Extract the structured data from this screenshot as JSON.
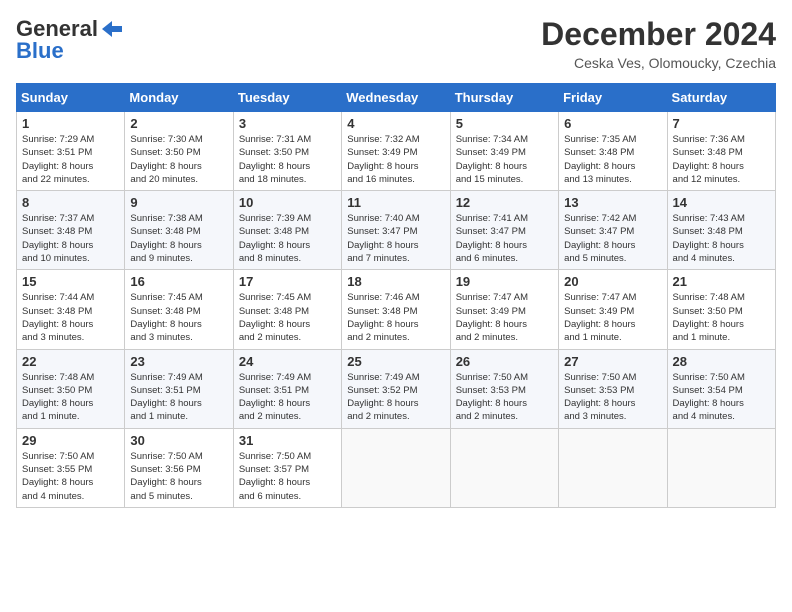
{
  "logo": {
    "line1": "General",
    "line2": "Blue"
  },
  "title": "December 2024",
  "location": "Ceska Ves, Olomoucky, Czechia",
  "days_of_week": [
    "Sunday",
    "Monday",
    "Tuesday",
    "Wednesday",
    "Thursday",
    "Friday",
    "Saturday"
  ],
  "weeks": [
    [
      {
        "day": 1,
        "sunrise": "7:29 AM",
        "sunset": "3:51 PM",
        "daylight": "8 hours and 22 minutes."
      },
      {
        "day": 2,
        "sunrise": "7:30 AM",
        "sunset": "3:50 PM",
        "daylight": "8 hours and 20 minutes."
      },
      {
        "day": 3,
        "sunrise": "7:31 AM",
        "sunset": "3:50 PM",
        "daylight": "8 hours and 18 minutes."
      },
      {
        "day": 4,
        "sunrise": "7:32 AM",
        "sunset": "3:49 PM",
        "daylight": "8 hours and 16 minutes."
      },
      {
        "day": 5,
        "sunrise": "7:34 AM",
        "sunset": "3:49 PM",
        "daylight": "8 hours and 15 minutes."
      },
      {
        "day": 6,
        "sunrise": "7:35 AM",
        "sunset": "3:48 PM",
        "daylight": "8 hours and 13 minutes."
      },
      {
        "day": 7,
        "sunrise": "7:36 AM",
        "sunset": "3:48 PM",
        "daylight": "8 hours and 12 minutes."
      }
    ],
    [
      {
        "day": 8,
        "sunrise": "7:37 AM",
        "sunset": "3:48 PM",
        "daylight": "8 hours and 10 minutes."
      },
      {
        "day": 9,
        "sunrise": "7:38 AM",
        "sunset": "3:48 PM",
        "daylight": "8 hours and 9 minutes."
      },
      {
        "day": 10,
        "sunrise": "7:39 AM",
        "sunset": "3:48 PM",
        "daylight": "8 hours and 8 minutes."
      },
      {
        "day": 11,
        "sunrise": "7:40 AM",
        "sunset": "3:47 PM",
        "daylight": "8 hours and 7 minutes."
      },
      {
        "day": 12,
        "sunrise": "7:41 AM",
        "sunset": "3:47 PM",
        "daylight": "8 hours and 6 minutes."
      },
      {
        "day": 13,
        "sunrise": "7:42 AM",
        "sunset": "3:47 PM",
        "daylight": "8 hours and 5 minutes."
      },
      {
        "day": 14,
        "sunrise": "7:43 AM",
        "sunset": "3:48 PM",
        "daylight": "8 hours and 4 minutes."
      }
    ],
    [
      {
        "day": 15,
        "sunrise": "7:44 AM",
        "sunset": "3:48 PM",
        "daylight": "8 hours and 3 minutes."
      },
      {
        "day": 16,
        "sunrise": "7:45 AM",
        "sunset": "3:48 PM",
        "daylight": "8 hours and 3 minutes."
      },
      {
        "day": 17,
        "sunrise": "7:45 AM",
        "sunset": "3:48 PM",
        "daylight": "8 hours and 2 minutes."
      },
      {
        "day": 18,
        "sunrise": "7:46 AM",
        "sunset": "3:48 PM",
        "daylight": "8 hours and 2 minutes."
      },
      {
        "day": 19,
        "sunrise": "7:47 AM",
        "sunset": "3:49 PM",
        "daylight": "8 hours and 2 minutes."
      },
      {
        "day": 20,
        "sunrise": "7:47 AM",
        "sunset": "3:49 PM",
        "daylight": "8 hours and 1 minute."
      },
      {
        "day": 21,
        "sunrise": "7:48 AM",
        "sunset": "3:50 PM",
        "daylight": "8 hours and 1 minute."
      }
    ],
    [
      {
        "day": 22,
        "sunrise": "7:48 AM",
        "sunset": "3:50 PM",
        "daylight": "8 hours and 1 minute."
      },
      {
        "day": 23,
        "sunrise": "7:49 AM",
        "sunset": "3:51 PM",
        "daylight": "8 hours and 1 minute."
      },
      {
        "day": 24,
        "sunrise": "7:49 AM",
        "sunset": "3:51 PM",
        "daylight": "8 hours and 2 minutes."
      },
      {
        "day": 25,
        "sunrise": "7:49 AM",
        "sunset": "3:52 PM",
        "daylight": "8 hours and 2 minutes."
      },
      {
        "day": 26,
        "sunrise": "7:50 AM",
        "sunset": "3:53 PM",
        "daylight": "8 hours and 2 minutes."
      },
      {
        "day": 27,
        "sunrise": "7:50 AM",
        "sunset": "3:53 PM",
        "daylight": "8 hours and 3 minutes."
      },
      {
        "day": 28,
        "sunrise": "7:50 AM",
        "sunset": "3:54 PM",
        "daylight": "8 hours and 4 minutes."
      }
    ],
    [
      {
        "day": 29,
        "sunrise": "7:50 AM",
        "sunset": "3:55 PM",
        "daylight": "8 hours and 4 minutes."
      },
      {
        "day": 30,
        "sunrise": "7:50 AM",
        "sunset": "3:56 PM",
        "daylight": "8 hours and 5 minutes."
      },
      {
        "day": 31,
        "sunrise": "7:50 AM",
        "sunset": "3:57 PM",
        "daylight": "8 hours and 6 minutes."
      },
      null,
      null,
      null,
      null
    ]
  ],
  "labels": {
    "sunrise": "Sunrise:",
    "sunset": "Sunset:",
    "daylight": "Daylight:"
  }
}
